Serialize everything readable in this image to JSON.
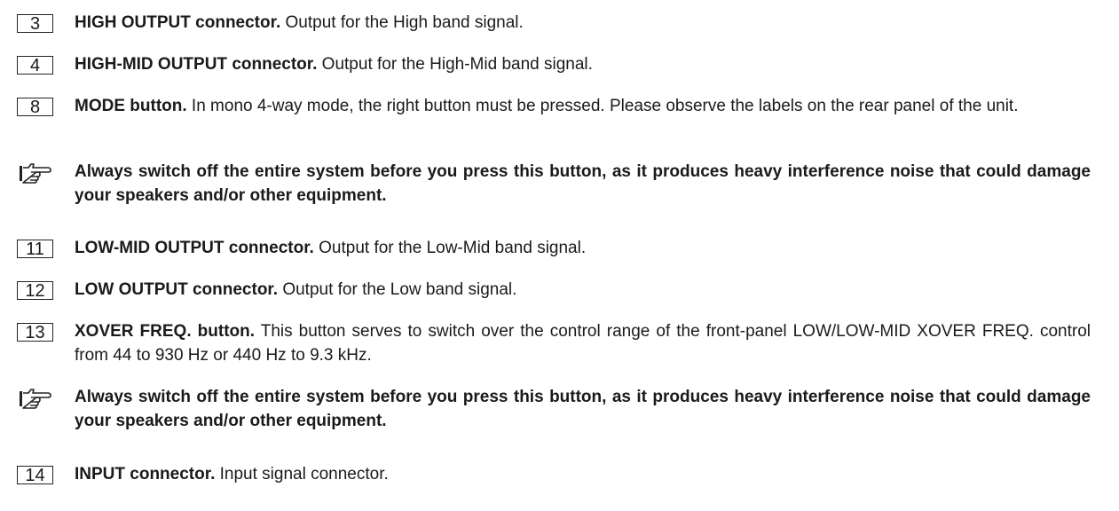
{
  "items": [
    {
      "number": "3",
      "title": "HIGH OUTPUT connector.",
      "body": " Output for the High band signal."
    },
    {
      "number": "4",
      "title": "HIGH-MID OUTPUT connector.",
      "body": " Output for the High-Mid band signal."
    },
    {
      "number": "8",
      "title": "MODE button.",
      "body": " In mono 4-way mode, the right button must be pressed. Please observe the labels on the rear panel of the unit."
    },
    {
      "number": "11",
      "title": "LOW-MID OUTPUT connector.",
      "body": " Output for the Low-Mid band signal."
    },
    {
      "number": "12",
      "title": "LOW OUTPUT connector.",
      "body": " Output for the Low band signal."
    },
    {
      "number": "13",
      "title": "XOVER FREQ. button.",
      "body": " This button serves to switch over the control range of the front-panel LOW/LOW-MID XOVER FREQ. control from 44 to 930 Hz or 440 Hz to 9.3 kHz."
    },
    {
      "number": "14",
      "title": "INPUT connector.",
      "body": " Input signal connector."
    }
  ],
  "notes": [
    {
      "icon": "pointing-hand-icon",
      "text": "Always switch off the entire system before you press this button, as it produces heavy interference noise that could damage your speakers and/or other equipment."
    },
    {
      "icon": "pointing-hand-icon",
      "text": "Always switch off the entire system before you press this button, as it produces heavy interference noise that could damage your speakers and/or other equipment."
    }
  ]
}
